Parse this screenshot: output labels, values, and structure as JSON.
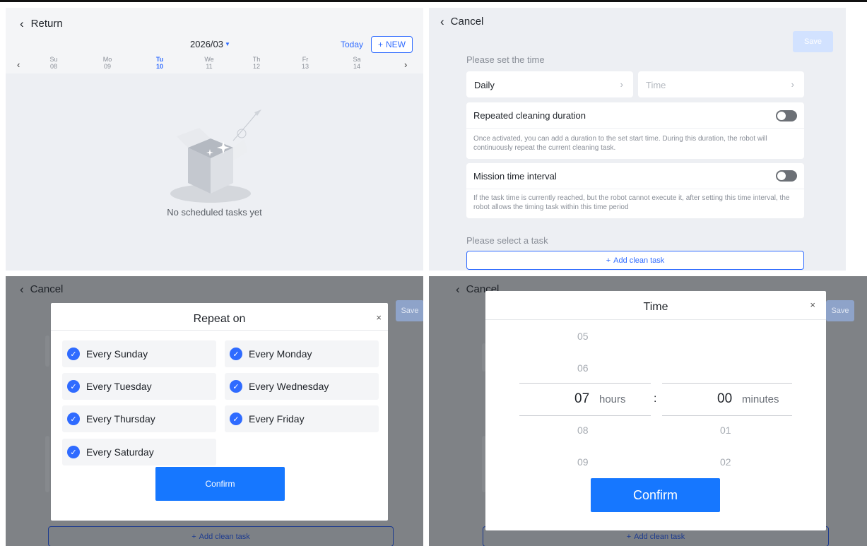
{
  "calendar": {
    "back_label": "Return",
    "month": "2026/03",
    "today_label": "Today",
    "new_label": "NEW",
    "days": [
      {
        "dow": "Su",
        "date": "08",
        "active": false
      },
      {
        "dow": "Mo",
        "date": "09",
        "active": false
      },
      {
        "dow": "Tu",
        "date": "10",
        "active": true
      },
      {
        "dow": "We",
        "date": "11",
        "active": false
      },
      {
        "dow": "Th",
        "date": "12",
        "active": false
      },
      {
        "dow": "Fr",
        "date": "13",
        "active": false
      },
      {
        "dow": "Sa",
        "date": "14",
        "active": false
      }
    ],
    "empty_text": "No scheduled tasks yet"
  },
  "settings": {
    "cancel_label": "Cancel",
    "save_label": "Save",
    "set_time_label": "Please set the time",
    "repeat_value": "Daily",
    "time_placeholder": "Time",
    "repeated_duration": {
      "title": "Repeated cleaning duration",
      "desc": "Once activated, you can add a duration to the set start time. During this duration, the robot will continuously repeat the current cleaning task.",
      "enabled": false
    },
    "mission_interval": {
      "title": "Mission time interval",
      "desc": "If the task time is currently reached, but the robot cannot execute it, after setting this time interval, the robot allows the timing task within this time period",
      "enabled": false
    },
    "select_task_label": "Please select a task",
    "add_task_label": "Add clean task"
  },
  "repeat_modal": {
    "title": "Repeat on",
    "close": "×",
    "options": [
      {
        "label": "Every Sunday",
        "checked": true
      },
      {
        "label": "Every Monday",
        "checked": true
      },
      {
        "label": "Every Tuesday",
        "checked": true
      },
      {
        "label": "Every Wednesday",
        "checked": true
      },
      {
        "label": "Every Thursday",
        "checked": true
      },
      {
        "label": "Every Friday",
        "checked": true
      },
      {
        "label": "Every Saturday",
        "checked": true
      }
    ],
    "confirm_label": "Confirm"
  },
  "time_modal": {
    "title": "Time",
    "close": "×",
    "hours_above": [
      "05",
      "06"
    ],
    "hours_selected": "07",
    "hours_unit": "hours",
    "hours_below": [
      "08",
      "09"
    ],
    "minutes_selected": "00",
    "minutes_unit": "minutes",
    "minutes_below": [
      "01",
      "02"
    ],
    "separator": ":",
    "confirm_label": "Confirm"
  },
  "background": {
    "cancel_label": "Cancel",
    "save_label": "Save",
    "add_task_label": "Add clean task"
  },
  "icons": {
    "back": "chevron-left-icon",
    "forward": "chevron-right-icon",
    "check": "check-circle-icon",
    "plus": "plus-icon"
  },
  "colors": {
    "accent": "#2f6bff",
    "button": "#1677ff",
    "page_bg": "#edeff3",
    "overlay": "#7f8286"
  }
}
